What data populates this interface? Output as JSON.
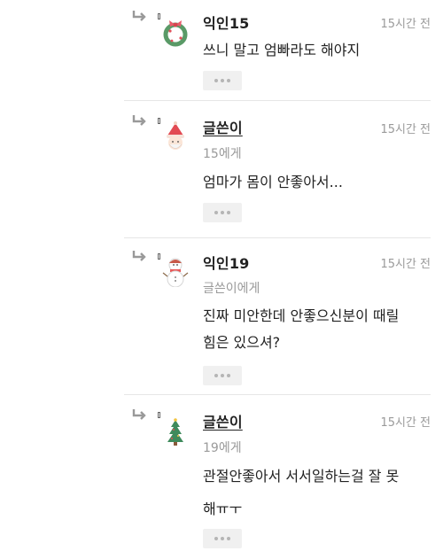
{
  "comments": [
    {
      "author": "익인15",
      "time": "15시간 전",
      "reply_to": "",
      "lines": [
        "쓰니 말고 엄빠라도 해야지"
      ],
      "avatar_icon": "wreath-icon"
    },
    {
      "author": "글쓴이",
      "time": "15시간 전",
      "reply_to": "15에게",
      "lines": [
        "엄마가 몸이 안좋아서..."
      ],
      "avatar_icon": "santa-icon"
    },
    {
      "author": "익인19",
      "time": "15시간 전",
      "reply_to": "글쓴이에게",
      "lines": [
        "진짜 미안한데 안좋으신분이 때릴",
        "힘은 있으셔?"
      ],
      "avatar_icon": "snowman-icon"
    },
    {
      "author": "글쓴이",
      "time": "15시간 전",
      "reply_to": "19에게",
      "lines": [
        "관절안좋아서 서서일하는걸 잘 못",
        "해ㅠㅜ"
      ],
      "avatar_icon": "christmas-tree-icon"
    }
  ],
  "icons": {
    "reply_arrow": "reply-arrow-icon",
    "more": "more-options-icon"
  }
}
